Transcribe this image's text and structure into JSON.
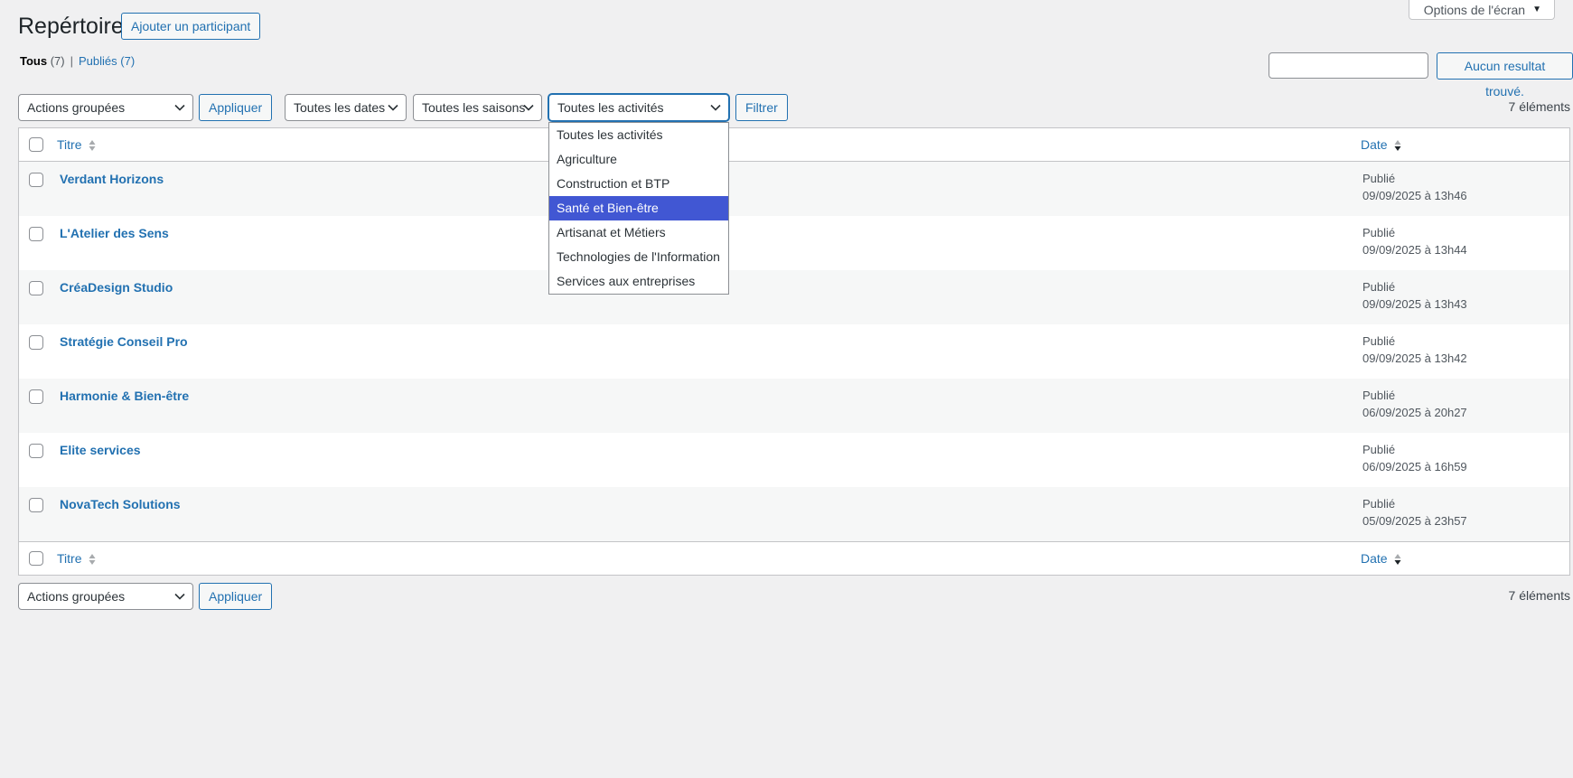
{
  "header": {
    "screen_options": "Options de l'écran",
    "title": "Repértoire",
    "add_button": "Ajouter un participant"
  },
  "views": {
    "all_label": "Tous",
    "all_count": "(7)",
    "separator": "|",
    "published_label": "Publiés",
    "published_count": "(7)"
  },
  "search": {
    "value": "",
    "button": "Aucun resultat trouvé."
  },
  "filters": {
    "bulk_actions": "Actions groupées",
    "apply": "Appliquer",
    "dates": "Toutes les dates",
    "seasons": "Toutes les saisons",
    "activities": "Toutes les activités",
    "filter_button": "Filtrer",
    "count": "7 éléments"
  },
  "activity_options": [
    "Toutes les activités",
    "Agriculture",
    "Construction et BTP",
    "Santé et Bien-être",
    "Artisanat et Métiers",
    "Technologies de l'Information",
    "Services aux entreprises"
  ],
  "activity_selected_index": 3,
  "table": {
    "col_title": "Titre",
    "col_date": "Date",
    "rows": [
      {
        "title": "Verdant Horizons",
        "status": "Publié",
        "date": "09/09/2025 à 13h46"
      },
      {
        "title": "L'Atelier des Sens",
        "status": "Publié",
        "date": "09/09/2025 à 13h44"
      },
      {
        "title": "CréaDesign Studio",
        "status": "Publié",
        "date": "09/09/2025 à 13h43"
      },
      {
        "title": "Stratégie Conseil Pro",
        "status": "Publié",
        "date": "09/09/2025 à 13h42"
      },
      {
        "title": "Harmonie & Bien-être",
        "status": "Publié",
        "date": "06/09/2025 à 20h27"
      },
      {
        "title": "Elite services",
        "status": "Publié",
        "date": "06/09/2025 à 16h59"
      },
      {
        "title": "NovaTech Solutions",
        "status": "Publié",
        "date": "05/09/2025 à 23h57"
      }
    ]
  },
  "bottom": {
    "bulk_actions": "Actions groupées",
    "apply": "Appliquer",
    "count": "7 éléments"
  },
  "colors": {
    "link": "#2271b1",
    "background": "#f0f0f1",
    "selected_option": "#4157d3"
  }
}
